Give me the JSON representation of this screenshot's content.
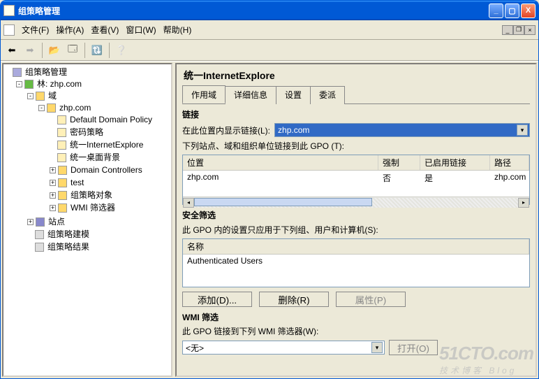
{
  "window": {
    "title": "组策略管理"
  },
  "menu": {
    "file": "文件(F)",
    "action": "操作(A)",
    "view": "查看(V)",
    "window": "窗口(W)",
    "help": "帮助(H)"
  },
  "tree": {
    "root": "组策略管理",
    "forest": "林: zhp.com",
    "domains": "域",
    "domain": "zhp.com",
    "ddp": "Default Domain Policy",
    "pwd": "密码策略",
    "ie": "统一InternetExplore",
    "desktop": "统一桌面背景",
    "dc": "Domain Controllers",
    "test": "test",
    "gpo_obj": "组策略对象",
    "wmi": "WMI 筛选器",
    "sites": "站点",
    "modeling": "组策略建模",
    "results": "组策略结果"
  },
  "right": {
    "title": "统一InternetExplore",
    "tabs": {
      "scope": "作用域",
      "details": "详细信息",
      "settings": "设置",
      "delegation": "委派"
    },
    "links": {
      "heading": "链接",
      "display_label": "在此位置内显示链接(L):",
      "display_value": "zhp.com",
      "sub": "下列站点、域和组织单位链接到此 GPO (T):",
      "cols": {
        "location": "位置",
        "enforced": "强制",
        "enabled": "已启用链接",
        "path": "路径"
      },
      "row1": {
        "loc": "zhp.com",
        "enf": "否",
        "en": "是",
        "path": "zhp.com"
      }
    },
    "security": {
      "heading": "安全筛选",
      "sub": "此 GPO 内的设置只应用于下列组、用户和计算机(S):",
      "col_name": "名称",
      "item1": "Authenticated Users",
      "add": "添加(D)...",
      "remove": "删除(R)",
      "props": "属性(P)"
    },
    "wmi": {
      "heading": "WMI 筛选",
      "sub": "此 GPO 链接到下列 WMI 筛选器(W):",
      "value": "<无>",
      "open": "打开(O)"
    }
  },
  "watermark": {
    "big": "51CTO.com",
    "small": "技术博客  Blog"
  }
}
